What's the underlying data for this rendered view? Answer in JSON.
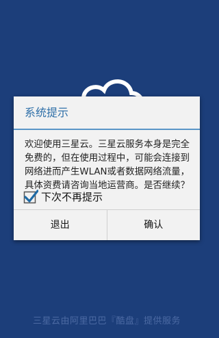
{
  "dialog": {
    "title": "系统提示",
    "message": "欢迎使用三星云。三星云服务本身是完全免费的，但在使用过程中，可能会连接到网络进而产生WLAN或者数据网络流量，具体资费请咨询当地运营商。是否继续？",
    "checkbox": {
      "label": "下次不再提示",
      "checked": true
    },
    "buttons": {
      "exit": "退出",
      "confirm": "确认"
    }
  },
  "footer": {
    "text": "三星云由阿里巴巴『酷盘』提供服务"
  },
  "colors": {
    "background": "#1c3e7a",
    "title": "#2e6fa8",
    "accent_line": "#5a95c7",
    "check": "#1e6aa5"
  },
  "icons": {
    "logo": "cloud-icon",
    "check": "checkmark-icon"
  }
}
